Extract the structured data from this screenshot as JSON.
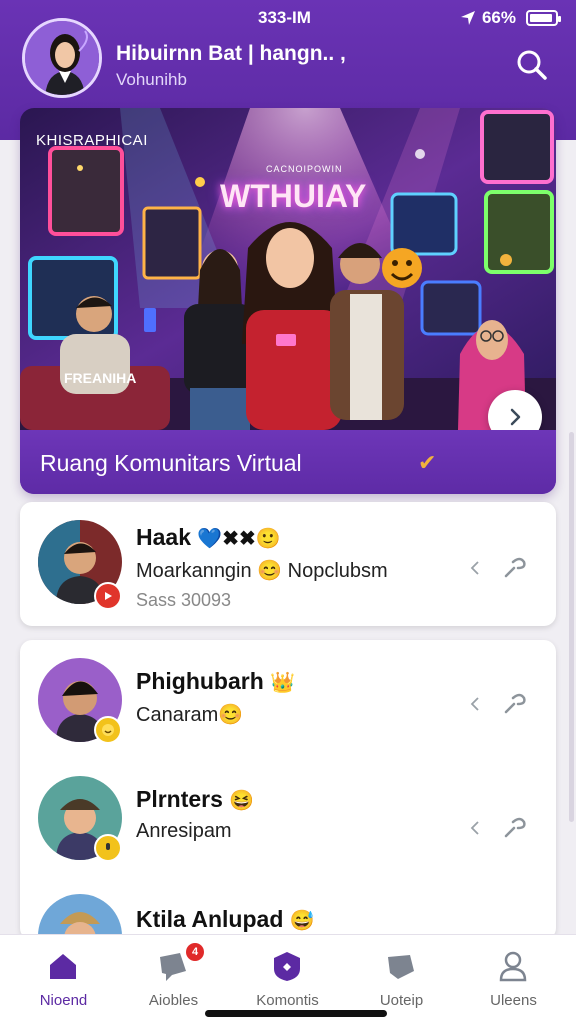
{
  "status_bar": {
    "time": "333-IM",
    "battery": "66%",
    "battery_level": 0.9
  },
  "header": {
    "title": "Hibuirnn Bat | hangn.. ,",
    "subtitle": "Vohunihb",
    "search_icon": "search-icon"
  },
  "hero": {
    "top_label": "KHISRAPHICAI",
    "sign_small": "CACNOIPOWIN",
    "sign_text": "WTHUIAY",
    "screen_text": "FREANIHA",
    "caption": "Ruang Komunitars Virtual",
    "caption_icon": "✔",
    "next_icon": "chevron-right-icon"
  },
  "feed": [
    {
      "name": "Haak",
      "name_emoji": "💙✖✖🙂",
      "message": "Moarkanngin 😊 Nopclubsm",
      "meta": "Sass 30093",
      "badge_color": "#e0352b"
    },
    {
      "name": "Phighubarh",
      "name_emoji": "👑",
      "message": "Canaram😊",
      "meta": "",
      "badge_color": "#f2c21b"
    },
    {
      "name": "Plrnters",
      "name_emoji": "😆",
      "message": "Anresipam",
      "meta": "",
      "badge_color": "#f2c21b"
    },
    {
      "name": "Ktila Anlupad",
      "name_emoji": "😅",
      "message": "",
      "meta": "",
      "badge_color": "#f2c21b"
    }
  ],
  "nav": [
    {
      "label": "Nioend",
      "icon": "home-icon",
      "active": true
    },
    {
      "label": "Aiobles",
      "icon": "chat-icon",
      "badge": "4",
      "active": false
    },
    {
      "label": "Komontis",
      "icon": "community-shield-icon",
      "active": false
    },
    {
      "label": "Uoteip",
      "icon": "tag-icon",
      "active": false
    },
    {
      "label": "Uleens",
      "icon": "profile-icon",
      "active": false
    }
  ],
  "colors": {
    "brand": "#5c2aa3",
    "accent": "#f2b33d",
    "card_bg": "#ffffff"
  }
}
